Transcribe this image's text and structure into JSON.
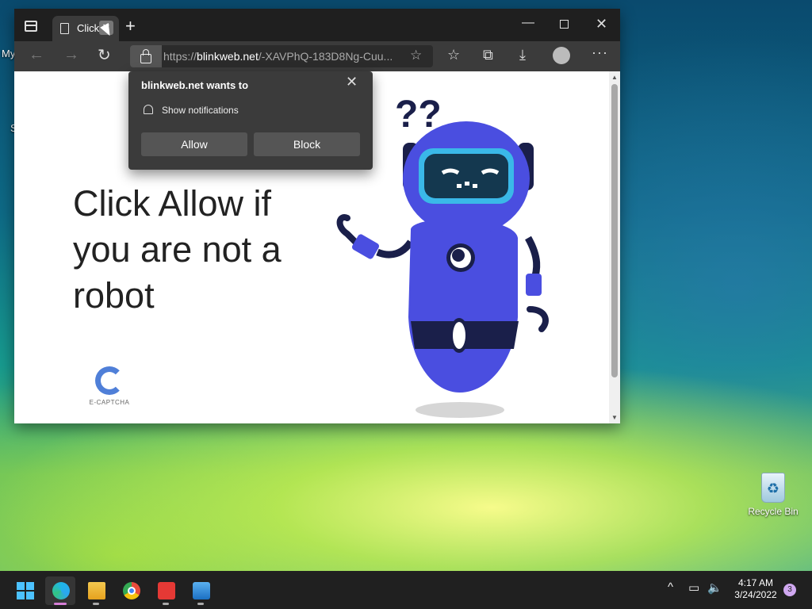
{
  "desktop": {
    "partial_icon_label_1": "My",
    "partial_icon_label_2": "S",
    "recycle_bin_label": "Recycle Bin"
  },
  "browser": {
    "tab": {
      "title": "Click",
      "close_glyph": "✕",
      "new_tab_glyph": "+"
    },
    "window_controls": {
      "minimize": "—",
      "close": "✕"
    },
    "toolbar": {
      "back_glyph": "←",
      "forward_glyph": "→",
      "refresh_glyph": "↻",
      "url_prefix": "https://",
      "url_domain": "blinkweb.net",
      "url_rest": "/-XAVPhQ-183D8Ng-Cuu...",
      "fav_add_glyph": "☆",
      "favorites_glyph": "☆",
      "collections_glyph": "⧉",
      "downloads_glyph": "⤓",
      "more_glyph": "···"
    }
  },
  "page": {
    "headline": "Click Allow if you are not a robot",
    "logo_text": "E-CAPTCHA"
  },
  "notification_prompt": {
    "title": "blinkweb.net wants to",
    "permission": "Show notifications",
    "allow_label": "Allow",
    "block_label": "Block",
    "close_glyph": "✕"
  },
  "taskbar": {
    "tray_chevron": "^",
    "time": "4:17 AM",
    "date": "3/24/2022",
    "notification_count": "3"
  },
  "icons": [
    "tab-actions-icon",
    "page-icon",
    "lock-icon",
    "favorite-add-icon",
    "favorites-icon",
    "collections-icon",
    "downloads-icon",
    "profile-icon",
    "bell-icon",
    "recycle-bin-icon",
    "start-icon",
    "edge-icon",
    "file-explorer-icon",
    "chrome-icon",
    "photos-icon",
    "network-icon",
    "volume-icon"
  ],
  "colors": {
    "robot_body": "#4a4ee0",
    "robot_visor": "#3ab8e8",
    "robot_dark": "#1a1f4a",
    "logo_blue": "#4f7fd8"
  }
}
